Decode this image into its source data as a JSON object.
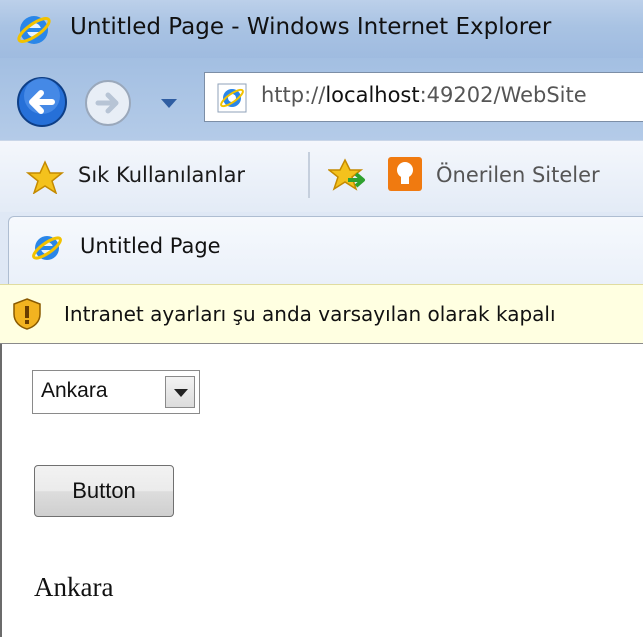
{
  "window": {
    "title": "Untitled Page - Windows Internet Explorer"
  },
  "navigation": {
    "address_prefix": "http://",
    "address_host": "localhost",
    "address_rest": ":49202/WebSite"
  },
  "favorites_bar": {
    "favorites_label": "Sık Kullanılanlar",
    "suggested_sites_label": "Önerilen Siteler"
  },
  "tab": {
    "label": "Untitled Page"
  },
  "infobar": {
    "message": "Intranet ayarları şu anda varsayılan olarak kapalı"
  },
  "page": {
    "dropdown_selected": "Ankara",
    "button_label": "Button",
    "result_label": "Ankara"
  },
  "colors": {
    "accent": "#1e6fd9",
    "infobar_bg": "#ffffe1",
    "suggest_icon": "#f07a10"
  },
  "icons": [
    "ie-logo-icon",
    "back-arrow-icon",
    "forward-arrow-icon",
    "star-icon",
    "add-favorite-icon",
    "suggested-sites-icon",
    "shield-warning-icon"
  ]
}
